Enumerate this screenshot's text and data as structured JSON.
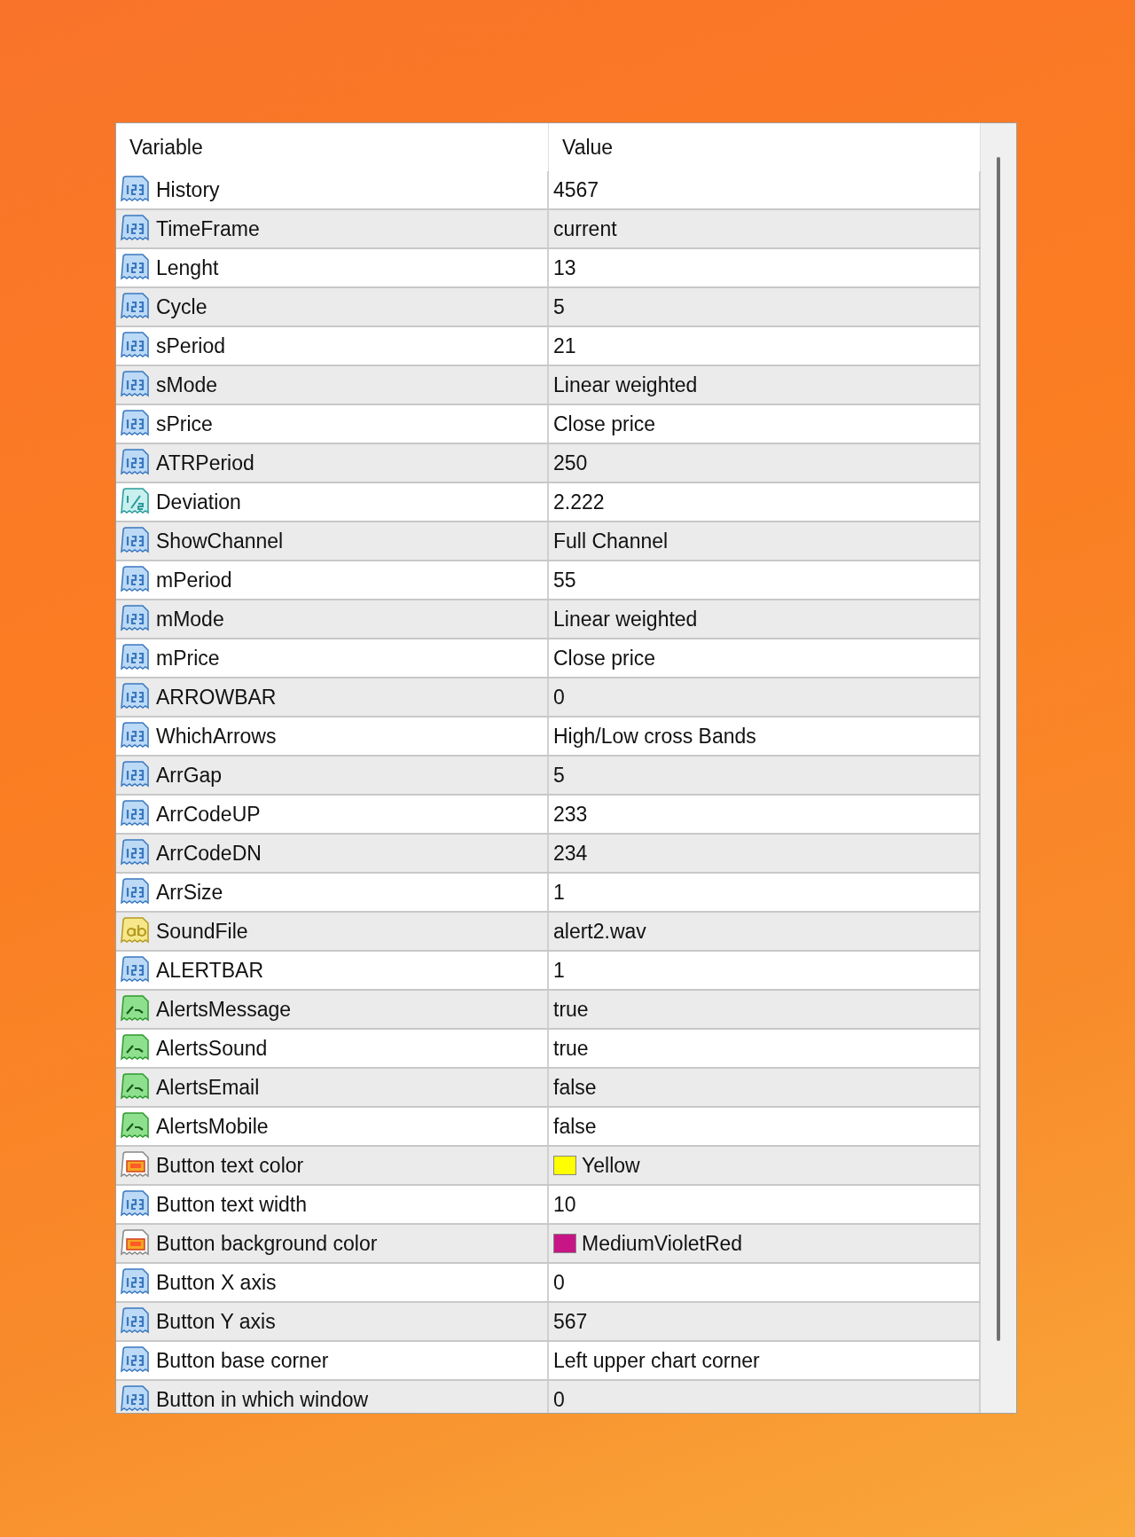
{
  "table": {
    "columns": [
      "Variable",
      "Value"
    ],
    "rows": [
      {
        "kind": "int",
        "variable": "History",
        "value": "4567"
      },
      {
        "kind": "int",
        "variable": "TimeFrame",
        "value": "current"
      },
      {
        "kind": "int",
        "variable": "Lenght",
        "value": "13"
      },
      {
        "kind": "int",
        "variable": "Cycle",
        "value": "5"
      },
      {
        "kind": "int",
        "variable": "sPeriod",
        "value": "21"
      },
      {
        "kind": "int",
        "variable": "sMode",
        "value": "Linear weighted"
      },
      {
        "kind": "int",
        "variable": "sPrice",
        "value": "Close price"
      },
      {
        "kind": "int",
        "variable": "ATRPeriod",
        "value": "250"
      },
      {
        "kind": "double",
        "variable": "Deviation",
        "value": "2.222"
      },
      {
        "kind": "int",
        "variable": "ShowChannel",
        "value": "Full Channel"
      },
      {
        "kind": "int",
        "variable": "mPeriod",
        "value": "55"
      },
      {
        "kind": "int",
        "variable": "mMode",
        "value": "Linear weighted"
      },
      {
        "kind": "int",
        "variable": "mPrice",
        "value": "Close price"
      },
      {
        "kind": "int",
        "variable": "ARROWBAR",
        "value": "0"
      },
      {
        "kind": "int",
        "variable": "WhichArrows",
        "value": "High/Low cross Bands"
      },
      {
        "kind": "int",
        "variable": "ArrGap",
        "value": "5"
      },
      {
        "kind": "int",
        "variable": "ArrCodeUP",
        "value": "233"
      },
      {
        "kind": "int",
        "variable": "ArrCodeDN",
        "value": "234"
      },
      {
        "kind": "int",
        "variable": "ArrSize",
        "value": "1"
      },
      {
        "kind": "string",
        "variable": "SoundFile",
        "value": "alert2.wav"
      },
      {
        "kind": "int",
        "variable": "ALERTBAR",
        "value": "1"
      },
      {
        "kind": "bool",
        "variable": "AlertsMessage",
        "value": "true"
      },
      {
        "kind": "bool",
        "variable": "AlertsSound",
        "value": "true"
      },
      {
        "kind": "bool",
        "variable": "AlertsEmail",
        "value": "false"
      },
      {
        "kind": "bool",
        "variable": "AlertsMobile",
        "value": "false"
      },
      {
        "kind": "color",
        "variable": "Button text color",
        "value": "Yellow",
        "color": "#ffff00"
      },
      {
        "kind": "int",
        "variable": "Button text width",
        "value": "10"
      },
      {
        "kind": "color",
        "variable": "Button background color",
        "value": "MediumVioletRed",
        "color": "#c71585"
      },
      {
        "kind": "int",
        "variable": "Button X axis",
        "value": "0"
      },
      {
        "kind": "int",
        "variable": "Button Y axis",
        "value": "567"
      },
      {
        "kind": "int",
        "variable": "Button base corner",
        "value": "Left upper chart corner"
      },
      {
        "kind": "int",
        "variable": "Button in which window",
        "value": "0"
      }
    ]
  }
}
